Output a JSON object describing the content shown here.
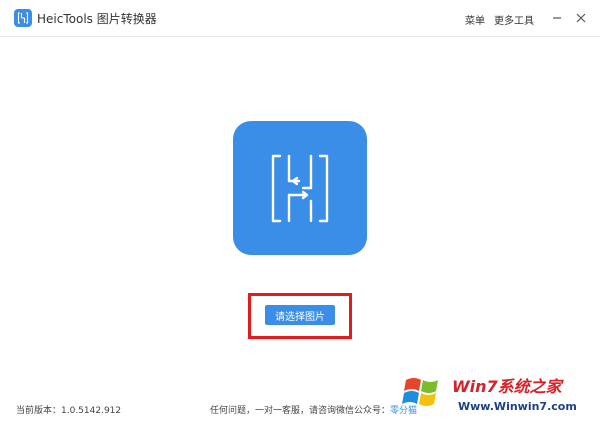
{
  "app": {
    "title": "HeicTools 图片转换器",
    "logo_icon": "heic-logo-icon"
  },
  "menu": {
    "menu_label": "菜单",
    "more_tools_label": "更多工具"
  },
  "window_controls": {
    "minimize_icon": "minimize-icon",
    "close_icon": "close-icon"
  },
  "main": {
    "hero_icon": "heic-convert-icon",
    "select_button_label": "请选择图片"
  },
  "footer": {
    "version_text": "当前版本：1.0.5142.912",
    "contact_prefix": "任何问题，一对一客服，请咨询微信公众号：",
    "contact_link": "零分猫"
  },
  "watermark": {
    "brand": "Win7系统之家",
    "url": "Www.Winwin7.com",
    "logo_icon": "windows-logo-icon"
  },
  "colors": {
    "accent": "#3b8ee8",
    "highlight": "#e31b1b",
    "watermark_red": "#d4222a",
    "watermark_blue": "#1d3f88"
  }
}
